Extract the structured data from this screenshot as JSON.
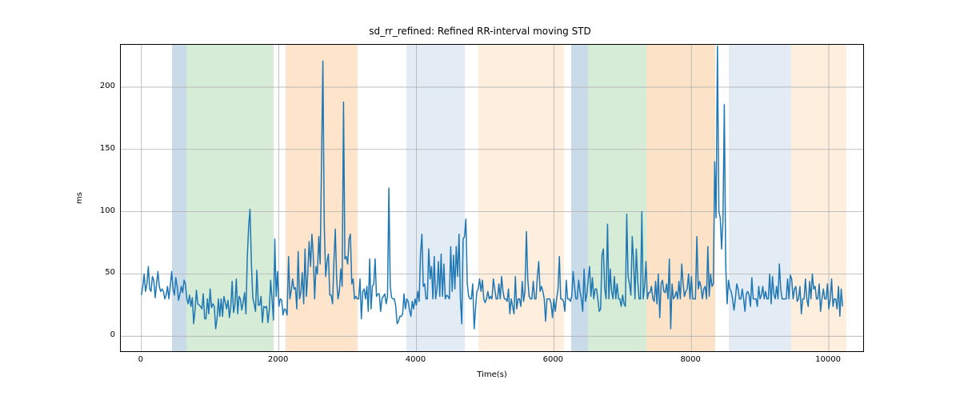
{
  "chart_data": {
    "type": "line",
    "title": "sd_rr_refined: Refined RR-interval moving STD",
    "xlabel": "Time(s)",
    "ylabel": "ms",
    "xlim": [
      -300,
      10500
    ],
    "ylim": [
      -12,
      234
    ],
    "xticks": [
      0,
      2000,
      4000,
      6000,
      8000,
      10000
    ],
    "yticks": [
      0,
      50,
      100,
      150,
      200
    ],
    "bands": [
      {
        "x0": 450,
        "x1": 650,
        "color": "#c9dbe9"
      },
      {
        "x0": 650,
        "x1": 1920,
        "color": "#d6ecd6"
      },
      {
        "x0": 2100,
        "x1": 3150,
        "color": "#fde4cb"
      },
      {
        "x0": 3850,
        "x1": 4700,
        "color": "#e3ecf5"
      },
      {
        "x0": 4900,
        "x1": 6150,
        "color": "#fdeedd"
      },
      {
        "x0": 6250,
        "x1": 6500,
        "color": "#c9dbe9"
      },
      {
        "x0": 6500,
        "x1": 7350,
        "color": "#d6ecd6"
      },
      {
        "x0": 7350,
        "x1": 8350,
        "color": "#fac58f",
        "alpha": 0.5
      },
      {
        "x0": 8550,
        "x1": 9450,
        "color": "#e3ecf5"
      },
      {
        "x0": 9450,
        "x1": 10250,
        "color": "#fdeedd"
      }
    ],
    "x": [
      0,
      20,
      40,
      60,
      80,
      100,
      120,
      140,
      160,
      180,
      200,
      220,
      240,
      260,
      280,
      300,
      320,
      340,
      360,
      380,
      400,
      420,
      440,
      460,
      480,
      500,
      520,
      540,
      560,
      580,
      600,
      620,
      640,
      660,
      680,
      700,
      720,
      740,
      760,
      780,
      800,
      820,
      840,
      860,
      880,
      900,
      920,
      940,
      960,
      980,
      1000,
      1020,
      1040,
      1060,
      1080,
      1100,
      1120,
      1140,
      1160,
      1180,
      1200,
      1220,
      1240,
      1260,
      1280,
      1300,
      1320,
      1340,
      1360,
      1380,
      1400,
      1420,
      1440,
      1460,
      1480,
      1500,
      1520,
      1540,
      1560,
      1580,
      1600,
      1620,
      1640,
      1660,
      1680,
      1700,
      1720,
      1740,
      1760,
      1780,
      1800,
      1820,
      1840,
      1860,
      1880,
      1900,
      1920,
      1940,
      1960,
      1980,
      2000,
      2020,
      2040,
      2060,
      2080,
      2100,
      2120,
      2140,
      2160,
      2180,
      2200,
      2220,
      2240,
      2260,
      2280,
      2300,
      2320,
      2340,
      2360,
      2380,
      2400,
      2420,
      2440,
      2460,
      2480,
      2500,
      2520,
      2540,
      2560,
      2580,
      2600,
      2620,
      2640,
      2660,
      2680,
      2700,
      2720,
      2740,
      2760,
      2780,
      2800,
      2820,
      2840,
      2860,
      2880,
      2900,
      2920,
      2940,
      2960,
      2980,
      3000,
      3020,
      3040,
      3060,
      3080,
      3100,
      3120,
      3140,
      3160,
      3180,
      3200,
      3220,
      3240,
      3260,
      3280,
      3300,
      3320,
      3340,
      3360,
      3380,
      3400,
      3420,
      3440,
      3460,
      3480,
      3500,
      3520,
      3540,
      3560,
      3580,
      3600,
      3620,
      3640,
      3660,
      3680,
      3700,
      3720,
      3740,
      3760,
      3780,
      3800,
      3820,
      3840,
      3860,
      3880,
      3900,
      3920,
      3940,
      3960,
      3980,
      4000,
      4020,
      4040,
      4060,
      4080,
      4100,
      4120,
      4140,
      4160,
      4180,
      4200,
      4220,
      4240,
      4260,
      4280,
      4300,
      4320,
      4340,
      4360,
      4380,
      4400,
      4420,
      4440,
      4460,
      4480,
      4500,
      4520,
      4540,
      4560,
      4580,
      4600,
      4620,
      4640,
      4660,
      4680,
      4700,
      4720,
      4740,
      4760,
      4780,
      4800,
      4820,
      4840,
      4860,
      4880,
      4900,
      4920,
      4940,
      4960,
      4980,
      5000,
      5020,
      5040,
      5060,
      5080,
      5100,
      5120,
      5140,
      5160,
      5180,
      5200,
      5220,
      5240,
      5260,
      5280,
      5300,
      5320,
      5340,
      5360,
      5380,
      5400,
      5420,
      5440,
      5460,
      5480,
      5500,
      5520,
      5540,
      5560,
      5580,
      5600,
      5620,
      5640,
      5660,
      5680,
      5700,
      5720,
      5740,
      5760,
      5780,
      5800,
      5820,
      5840,
      5860,
      5880,
      5900,
      5920,
      5940,
      5960,
      5980,
      6000,
      6020,
      6040,
      6060,
      6080,
      6100,
      6120,
      6140,
      6160,
      6180,
      6200,
      6220,
      6240,
      6260,
      6280,
      6300,
      6320,
      6340,
      6360,
      6380,
      6400,
      6420,
      6440,
      6460,
      6480,
      6500,
      6520,
      6540,
      6560,
      6580,
      6600,
      6620,
      6640,
      6660,
      6680,
      6700,
      6720,
      6740,
      6760,
      6780,
      6800,
      6820,
      6840,
      6860,
      6880,
      6900,
      6920,
      6940,
      6960,
      6980,
      7000,
      7020,
      7040,
      7060,
      7080,
      7100,
      7120,
      7140,
      7160,
      7180,
      7200,
      7220,
      7240,
      7260,
      7280,
      7300,
      7320,
      7340,
      7360,
      7380,
      7400,
      7420,
      7440,
      7460,
      7480,
      7500,
      7520,
      7540,
      7560,
      7580,
      7600,
      7620,
      7640,
      7660,
      7680,
      7700,
      7720,
      7740,
      7760,
      7780,
      7800,
      7820,
      7840,
      7860,
      7880,
      7900,
      7920,
      7940,
      7960,
      7980,
      8000,
      8020,
      8040,
      8060,
      8080,
      8100,
      8120,
      8140,
      8160,
      8180,
      8200,
      8220,
      8240,
      8260,
      8280,
      8300,
      8320,
      8340,
      8360,
      8380,
      8400,
      8420,
      8440,
      8460,
      8480,
      8500,
      8520,
      8540,
      8560,
      8580,
      8600,
      8620,
      8640,
      8660,
      8680,
      8700,
      8720,
      8740,
      8760,
      8780,
      8800,
      8820,
      8840,
      8860,
      8880,
      8900,
      8920,
      8940,
      8960,
      8980,
      9000,
      9020,
      9040,
      9060,
      9080,
      9100,
      9120,
      9140,
      9160,
      9180,
      9200,
      9220,
      9240,
      9260,
      9280,
      9300,
      9320,
      9340,
      9360,
      9380,
      9400,
      9420,
      9440,
      9460,
      9480,
      9500,
      9520,
      9540,
      9560,
      9580,
      9600,
      9620,
      9640,
      9660,
      9680,
      9700,
      9720,
      9740,
      9760,
      9780,
      9800,
      9820,
      9840,
      9860,
      9880,
      9900,
      9920,
      9940,
      9960,
      9980,
      10000,
      10020,
      10040,
      10060,
      10080,
      10100,
      10120,
      10140,
      10160,
      10180,
      10200
    ],
    "y": [
      33,
      40,
      50,
      36,
      42,
      56,
      38,
      36,
      48,
      45,
      31,
      42,
      52,
      40,
      36,
      38,
      36,
      30,
      33,
      40,
      30,
      41,
      52,
      38,
      33,
      47,
      40,
      29,
      34,
      40,
      35,
      45,
      42,
      30,
      26,
      33,
      24,
      31,
      10,
      21,
      37,
      26,
      25,
      24,
      22,
      34,
      14,
      14,
      30,
      18,
      38,
      23,
      26,
      24,
      6,
      14,
      30,
      16,
      30,
      16,
      32,
      27,
      22,
      29,
      15,
      24,
      44,
      19,
      25,
      46,
      18,
      32,
      30,
      21,
      27,
      35,
      18,
      63,
      88,
      102,
      58,
      31,
      26,
      20,
      53,
      25,
      25,
      32,
      11,
      24,
      23,
      24,
      11,
      21,
      45,
      30,
      13,
      78,
      32,
      52,
      24,
      30,
      29,
      17,
      22,
      21,
      17,
      64,
      30,
      37,
      46,
      38,
      39,
      22,
      68,
      30,
      35,
      51,
      26,
      70,
      32,
      50,
      76,
      56,
      82,
      65,
      30,
      56,
      50,
      80,
      58,
      140,
      221,
      90,
      48,
      60,
      66,
      33,
      33,
      26,
      60,
      86,
      46,
      30,
      36,
      54,
      40,
      188,
      62,
      64,
      58,
      78,
      82,
      42,
      46,
      30,
      32,
      30,
      30,
      46,
      14,
      36,
      38,
      30,
      40,
      20,
      62,
      22,
      40,
      42,
      62,
      32,
      34,
      34,
      20,
      30,
      32,
      34,
      26,
      32,
      119,
      40,
      31,
      30,
      30,
      24,
      10,
      12,
      16,
      16,
      18,
      34,
      22,
      30,
      28,
      21,
      16,
      28,
      22,
      30,
      25,
      36,
      28,
      66,
      82,
      40,
      42,
      30,
      30,
      70,
      46,
      56,
      30,
      64,
      30,
      38,
      60,
      32,
      66,
      32,
      58,
      30,
      33,
      32,
      30,
      72,
      36,
      65,
      38,
      72,
      48,
      82,
      30,
      10,
      78,
      80,
      94,
      42,
      32,
      30,
      30,
      42,
      6,
      22,
      36,
      38,
      46,
      36,
      45,
      30,
      27,
      30,
      36,
      30,
      32,
      30,
      46,
      38,
      30,
      30,
      42,
      30,
      48,
      36,
      30,
      30,
      28,
      38,
      18,
      30,
      24,
      18,
      48,
      22,
      30,
      30,
      24,
      44,
      28,
      36,
      84,
      46,
      32,
      30,
      30,
      44,
      30,
      30,
      48,
      60,
      36,
      40,
      36,
      30,
      12,
      30,
      30,
      30,
      26,
      15,
      30,
      20,
      30,
      38,
      64,
      30,
      30,
      28,
      20,
      45,
      30,
      30,
      28,
      32,
      52,
      40,
      30,
      30,
      45,
      36,
      30,
      20,
      54,
      28,
      34,
      46,
      56,
      32,
      47,
      30,
      38,
      38,
      30,
      20,
      22,
      65,
      70,
      38,
      30,
      90,
      30,
      54,
      36,
      30,
      48,
      30,
      42,
      30,
      30,
      24,
      33,
      26,
      24,
      98,
      48,
      42,
      33,
      80,
      60,
      30,
      70,
      44,
      30,
      30,
      100,
      30,
      40,
      60,
      30,
      35,
      35,
      40,
      30,
      28,
      44,
      26,
      50,
      15,
      42,
      45,
      36,
      35,
      42,
      30,
      62,
      6,
      42,
      30,
      32,
      36,
      30,
      44,
      30,
      58,
      42,
      32,
      36,
      38,
      50,
      30,
      48,
      30,
      30,
      30,
      80,
      38,
      44,
      40,
      30,
      38,
      40,
      30,
      72,
      32,
      50,
      40,
      42,
      140,
      95,
      233,
      100,
      95,
      70,
      93,
      186,
      58,
      26,
      45,
      38,
      36,
      30,
      21,
      30,
      42,
      38,
      30,
      30,
      38,
      30,
      20,
      34,
      36,
      33,
      24,
      47,
      30,
      30,
      30,
      24,
      40,
      30,
      33,
      40,
      30,
      36,
      30,
      30,
      50,
      26,
      48,
      34,
      30,
      40,
      30,
      58,
      38,
      30,
      30,
      30,
      30,
      46,
      30,
      49,
      46,
      30,
      38,
      40,
      28,
      30,
      40,
      18,
      30,
      30,
      46,
      30,
      24,
      44,
      30,
      50,
      38,
      40,
      30,
      30,
      42,
      20,
      30,
      38,
      30,
      30,
      42,
      22,
      30,
      46,
      24,
      30,
      30,
      22,
      40,
      16,
      38,
      24
    ]
  }
}
